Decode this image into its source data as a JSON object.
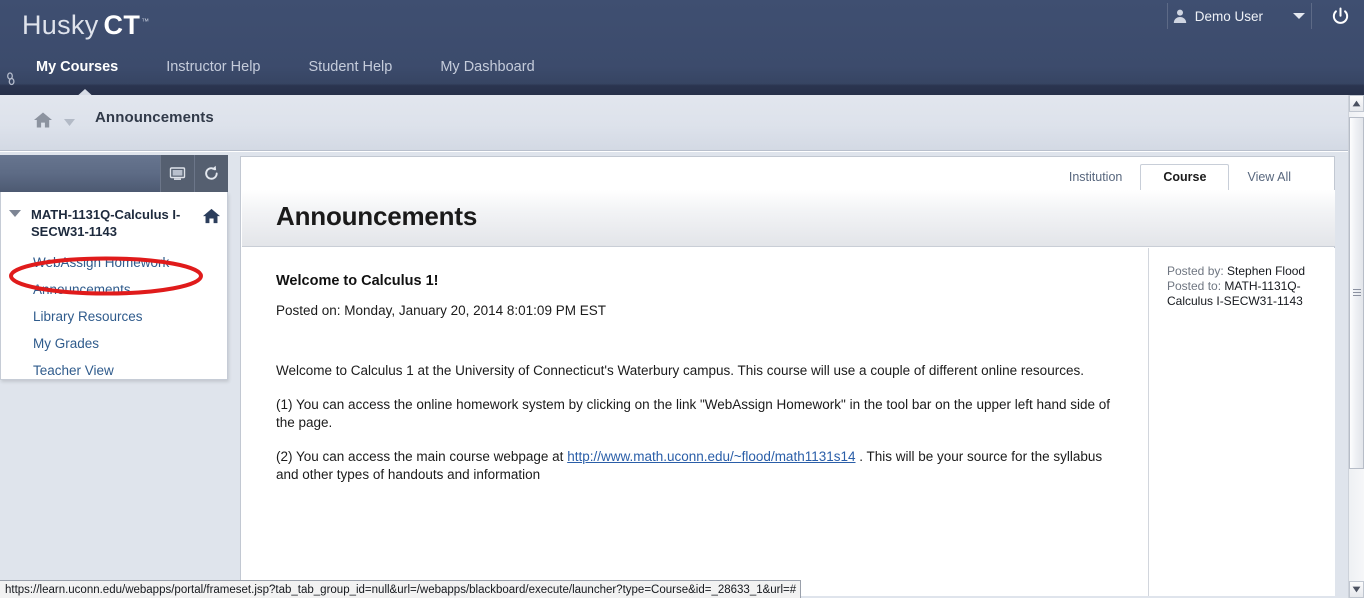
{
  "header": {
    "brand_light": "Husky",
    "brand_bold": "CT",
    "brand_tm": "™",
    "edge_icon": "link-icon",
    "nav_tabs": [
      {
        "label": "My Courses",
        "active": true
      },
      {
        "label": "Instructor Help",
        "active": false
      },
      {
        "label": "Student Help",
        "active": false
      },
      {
        "label": "My Dashboard",
        "active": false
      }
    ],
    "user": {
      "name": "Demo User",
      "icon": "person-icon",
      "caret_icon": "chevron-down-icon"
    },
    "power": {
      "icon": "power-icon",
      "label": "Logout"
    },
    "colors": {
      "navy": "#3c4b6c",
      "navy_dark": "#273049"
    }
  },
  "breadcrumb": {
    "home_icon": "home-icon",
    "caret_icon": "chevron-down-icon",
    "title": "Announcements"
  },
  "sidebar": {
    "toolbar": {
      "display_icon": "display-screen-icon",
      "refresh_icon": "refresh-icon"
    },
    "course": {
      "title": "MATH-1131Q-Calculus I-SECW31-1143",
      "collapse_icon": "triangle-down-icon",
      "home_icon": "home-icon"
    },
    "items": [
      {
        "label": "WebAssign Homework",
        "highlighted": true
      },
      {
        "label": "Announcements",
        "highlighted": false
      },
      {
        "label": "Library Resources",
        "highlighted": false
      },
      {
        "label": "My Grades",
        "highlighted": false
      },
      {
        "label": "Teacher View",
        "highlighted": false
      }
    ],
    "annotation": {
      "shape": "red-ellipse",
      "color": "#e01b1b",
      "target": "WebAssign Homework"
    }
  },
  "content": {
    "tabs": [
      {
        "label": "Institution",
        "active": false
      },
      {
        "label": "Course",
        "active": true
      },
      {
        "label": "View All",
        "active": false
      }
    ],
    "page_title": "Announcements",
    "announcement": {
      "heading": "Welcome to Calculus 1!",
      "posted_on": "Posted on: Monday, January 20, 2014 8:01:09 PM EST",
      "paragraph_1": "Welcome to Calculus 1 at the University of Connecticut's Waterbury campus. This course will use a couple of different online resources.",
      "paragraph_2": "(1) You can access the online homework system by clicking on the link \"WebAssign Homework\" in the tool bar on the upper left hand side of the page.",
      "paragraph_3_pre": "(2) You can access the main course webpage at ",
      "paragraph_3_link": "http://www.math.uconn.edu/~flood/math1131s14",
      "paragraph_3_post": " .  This will be your source for the syllabus and other types of handouts and information",
      "posted_by_label": "Posted by:",
      "posted_by_value": "Stephen Flood",
      "posted_to_label": "Posted to:",
      "posted_to_value": "MATH-1131Q-Calculus I-SECW31-1143"
    }
  },
  "scrollbar": {
    "up_icon": "triangle-up-icon",
    "down_icon": "triangle-down-icon",
    "thumb_grip_icon": "grip-icon"
  },
  "status_bar": {
    "url": "https://learn.uconn.edu/webapps/portal/frameset.jsp?tab_tab_group_id=null&url=/webapps/blackboard/execute/launcher?type=Course&id=_28633_1&url=#"
  }
}
